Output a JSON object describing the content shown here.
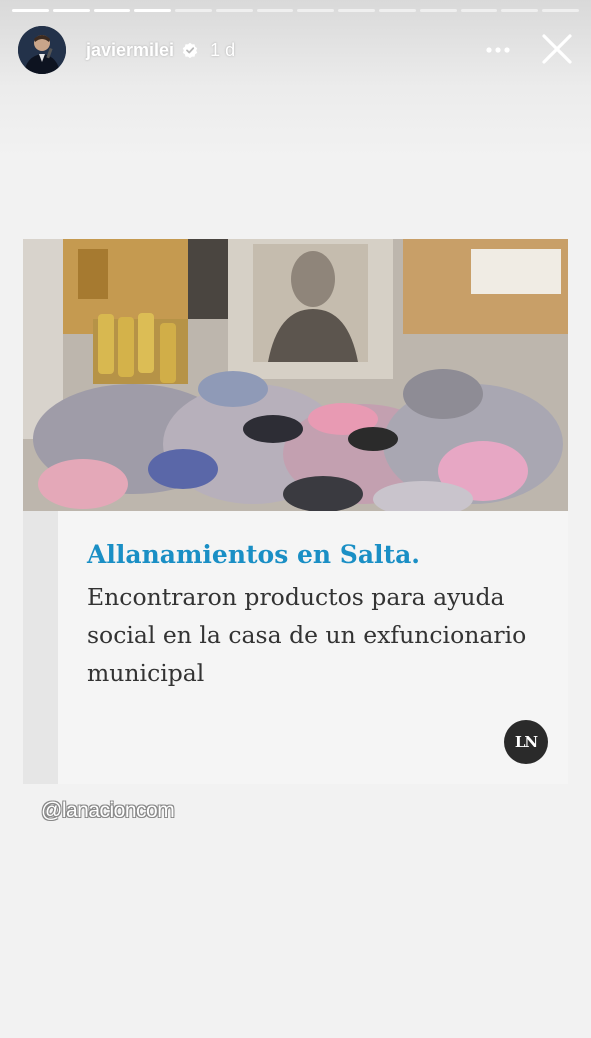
{
  "story": {
    "progress_segments": 14,
    "progress_done": 4
  },
  "header": {
    "username": "javiermilei",
    "time": "1 d"
  },
  "icons": {
    "verified": "verified-badge-icon",
    "more": "more-options-icon",
    "close": "close-icon"
  },
  "article": {
    "headline": "Allanamientos en Salta.",
    "summary": "Encontraron productos para ayuda social en la casa de un exfuncionario municipal",
    "logo": "LN"
  },
  "mention": "@lanacioncom",
  "colors": {
    "headline": "#1a8fc5",
    "summary": "#333333",
    "background": "#f2f2f2"
  }
}
